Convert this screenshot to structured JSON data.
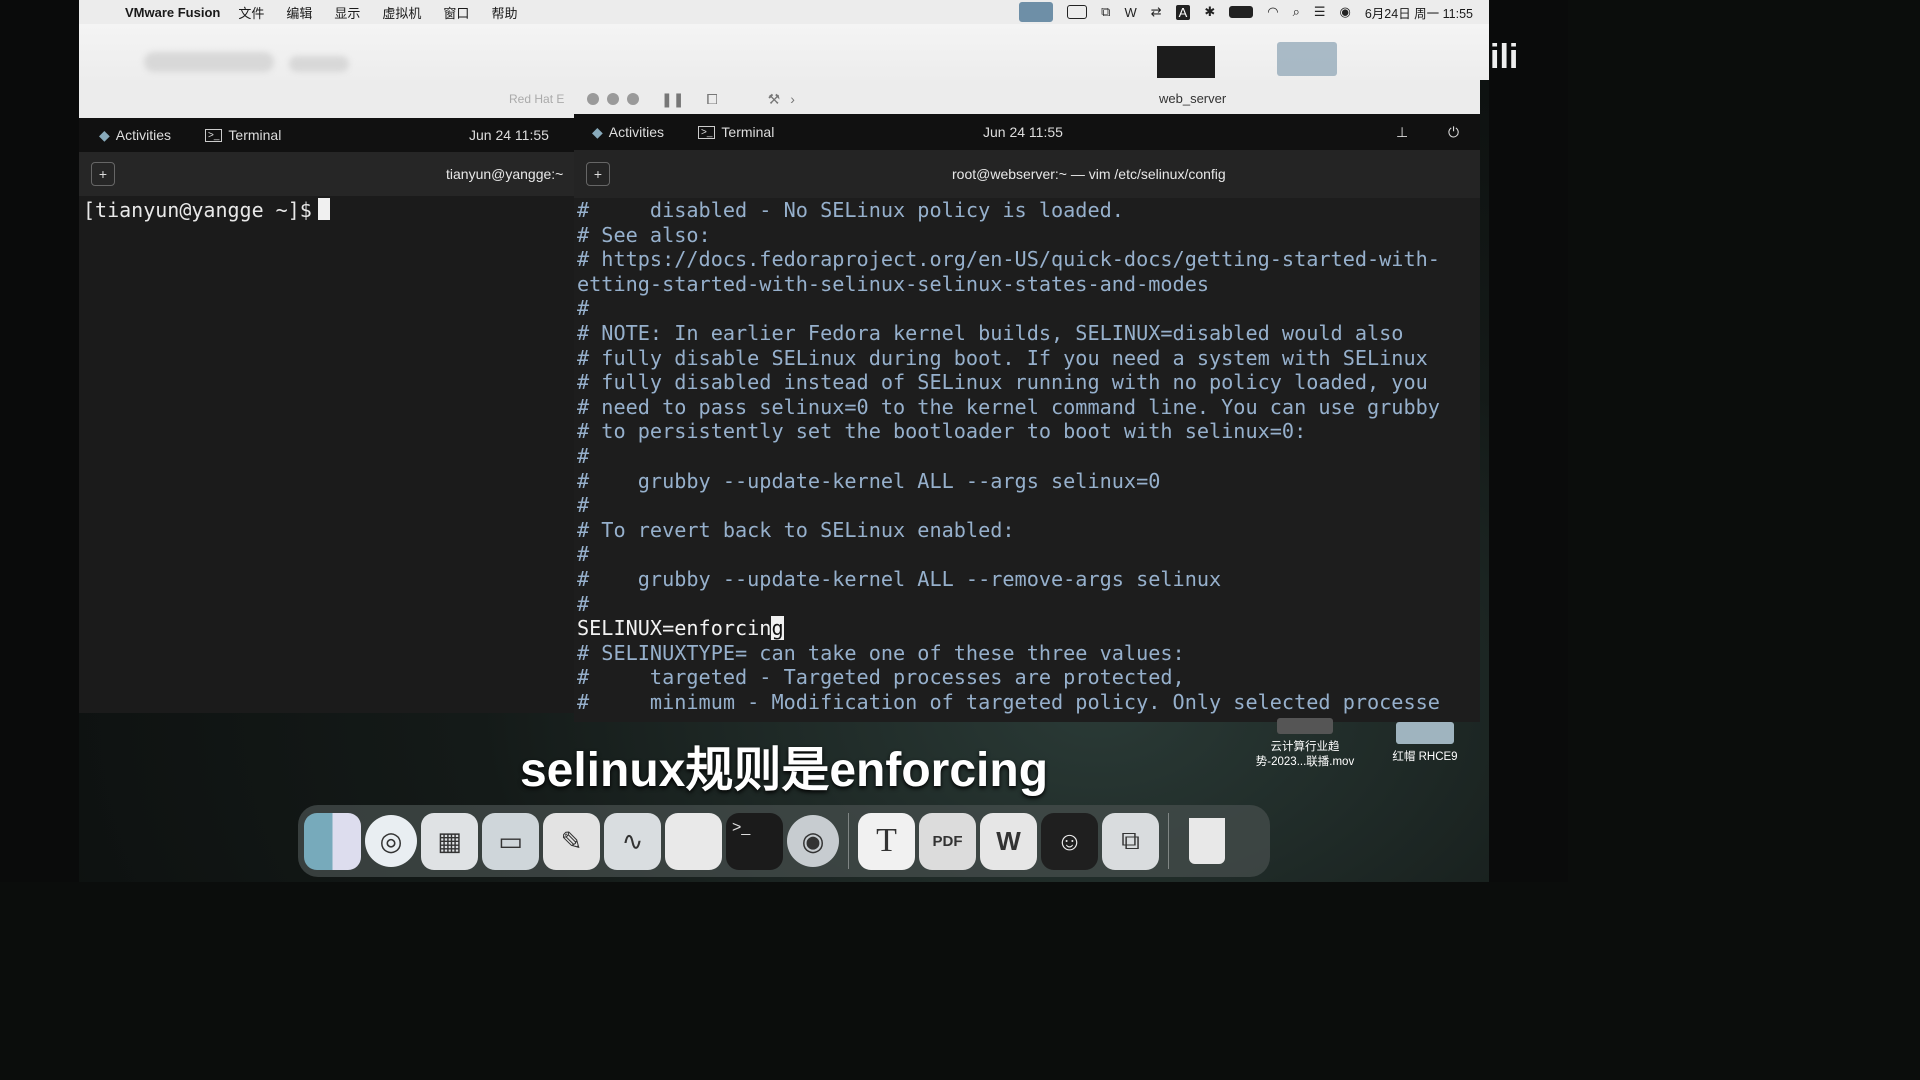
{
  "menubar": {
    "app_name": "VMware Fusion",
    "menus": [
      "文件",
      "编辑",
      "显示",
      "虚拟机",
      "窗口",
      "帮助"
    ],
    "datetime": "6月24日 周一 11:55"
  },
  "vm_toolbar": {
    "left_tab": "Red Hat E",
    "right_tab": "web_server"
  },
  "left_vm": {
    "activities": "Activities",
    "terminal": "Terminal",
    "clock": "Jun 24 11:55",
    "title": "tianyun@yangge:~",
    "prompt": "[tianyun@yangge ~]$"
  },
  "right_vm": {
    "activities": "Activities",
    "terminal": "Terminal",
    "clock": "Jun 24 11:55",
    "title": "root@webserver:~ — vim /etc/selinux/config",
    "lines": [
      "#     disabled - No SELinux policy is loaded.",
      "# See also:",
      "# https://docs.fedoraproject.org/en-US/quick-docs/getting-started-with-",
      "etting-started-with-selinux-selinux-states-and-modes",
      "#",
      "# NOTE: In earlier Fedora kernel builds, SELINUX=disabled would also",
      "# fully disable SELinux during boot. If you need a system with SELinux",
      "# fully disabled instead of SELinux running with no policy loaded, you",
      "# need to pass selinux=0 to the kernel command line. You can use grubby",
      "# to persistently set the bootloader to boot with selinux=0:",
      "#",
      "#    grubby --update-kernel ALL --args selinux=0",
      "#",
      "# To revert back to SELinux enabled:",
      "#",
      "#    grubby --update-kernel ALL --remove-args selinux",
      "#"
    ],
    "active_line_before": "SELINUX=enforcin",
    "active_line_cursor": "g",
    "lines_after": [
      "# SELINUXTYPE= can take one of these three values:",
      "#     targeted - Targeted processes are protected,",
      "#     minimum - Modification of targeted policy. Only selected processe"
    ]
  },
  "subtitle": "selinux规则是enforcing",
  "desktop_icons": [
    {
      "label_line1": "云计算行业趋",
      "label_line2": "势-2023...联播.mov"
    },
    {
      "label_line1": "红帽 RHCE9",
      "label_line2": ""
    }
  ],
  "dock_items": [
    "finder-icon",
    "safari-icon",
    "launchpad-icon",
    "preview-icon",
    "textedit-icon",
    "freeform-icon",
    "files-icon",
    "terminal-icon",
    "disk-utility-icon",
    "typora-icon",
    "pdf-icon",
    "wps-icon",
    "chat-bot-icon",
    "vmware-icon",
    "trash-icon"
  ],
  "dock_labels": {
    "typora": "T",
    "pdf": "PDF"
  }
}
